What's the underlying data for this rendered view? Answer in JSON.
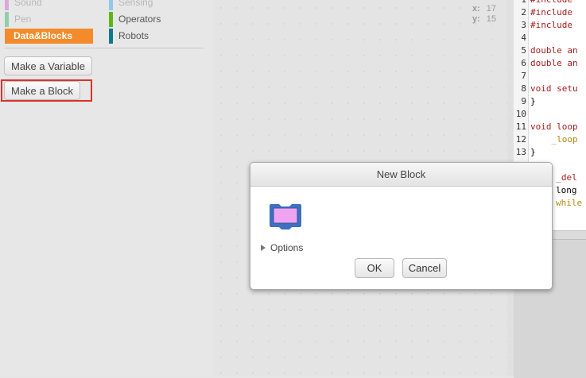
{
  "palette": {
    "categories": [
      {
        "label": "Sound",
        "color": "#cf63cf",
        "faded": true
      },
      {
        "label": "Sensing",
        "color": "#2ca5e2",
        "faded": true
      },
      {
        "label": "Pen",
        "color": "#0e9a6c",
        "faded": true
      },
      {
        "label": "Operators",
        "color": "#5cb712",
        "faded": false
      },
      {
        "label": "Data&Blocks",
        "color": "#f38b2b",
        "faded": false,
        "selected": true
      },
      {
        "label": "Robots",
        "color": "#0a7a8c",
        "faded": false
      }
    ],
    "make_variable_label": "Make a Variable",
    "make_block_label": "Make a Block"
  },
  "stage_coords": {
    "x_label": "x:",
    "x_value": "17",
    "y_label": "y:",
    "y_value": "15"
  },
  "code_panel": {
    "lines": [
      {
        "num": "1",
        "text": "#include"
      },
      {
        "num": "2",
        "text": "#include"
      },
      {
        "num": "3",
        "text": "#include"
      },
      {
        "num": "4",
        "text": ""
      },
      {
        "num": "5",
        "text": "double an"
      },
      {
        "num": "6",
        "text": "double an"
      },
      {
        "num": "7",
        "text": ""
      },
      {
        "num": "8",
        "text": "void setu"
      },
      {
        "num": "9",
        "text": "}"
      },
      {
        "num": "10",
        "text": ""
      },
      {
        "num": "11",
        "text": "void loop"
      },
      {
        "num": "12",
        "text": "    _loop"
      },
      {
        "num": "13",
        "text": "}"
      }
    ],
    "extra_lines": [
      "d _del",
      "long ",
      "while"
    ]
  },
  "dialog": {
    "title": "New Block",
    "options_label": "Options",
    "ok_label": "OK",
    "cancel_label": "Cancel",
    "block_color": "#f0a4f0",
    "block_border_color": "#3d74c9"
  }
}
